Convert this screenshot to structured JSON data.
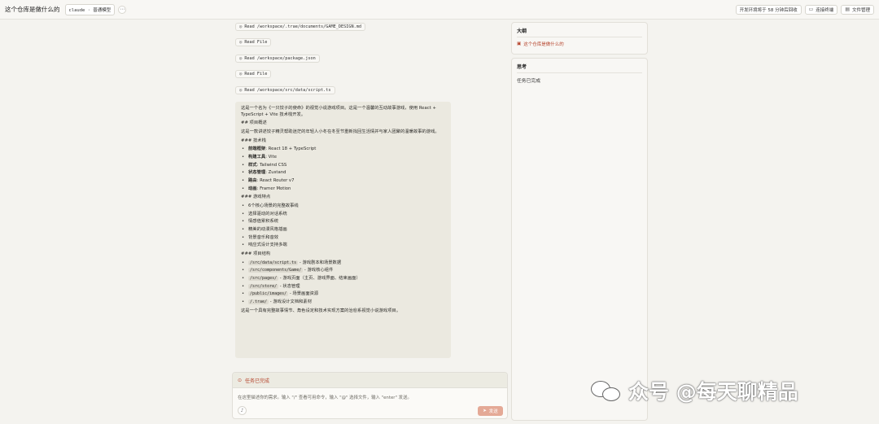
{
  "topbar": {
    "title": "这个仓库是做什么的",
    "model": "claude · 普通模型",
    "more": "⋯",
    "env_notice": "开发环境将于 58 分钟后回收",
    "connect_terminal": "连接终端",
    "file_manager": "文件管理"
  },
  "tool_calls": [
    {
      "label": "Read /workspace/.trae/documents/GAME_DESIGN.md"
    },
    {
      "label": "Read File"
    },
    {
      "label": "Read /workspace/package.json"
    },
    {
      "label": "Read File"
    },
    {
      "label": "Read /workspace/src/data/script.ts"
    }
  ],
  "answer": {
    "intro": "这是一个名为《一只饺子的使命》的视觉小说游戏项目。这是一个温馨的互动故事游戏，使用 React + TypeScript + Vite 技术栈开发。",
    "h_overview": "## 项目概述",
    "overview": "这是一款讲述饺子精灵帮助迷茫的年轻人小冬在冬至节重新找回生活情并与家人团聚的温暖故事的游戏。",
    "h_tech": "### 技术栈",
    "tech": [
      {
        "k": "前端框架",
        "v": ": React 18 + TypeScript"
      },
      {
        "k": "构建工具",
        "v": ": Vite"
      },
      {
        "k": "样式",
        "v": ": Tailwind CSS"
      },
      {
        "k": "状态管理",
        "v": ": Zustand"
      },
      {
        "k": "路由",
        "v": ": React Router v7"
      },
      {
        "k": "动画",
        "v": ": Framer Motion"
      }
    ],
    "h_features": "### 游戏特点",
    "features": [
      "6个核心场景的完整故事线",
      "选择驱动的对话系统",
      "情感值累积系统",
      "精美的动漫风格插画",
      "背景音乐和音效",
      "响应式设计支持多端"
    ],
    "h_structure": "### 项目结构",
    "structure": [
      {
        "path": "/src/data/script.ts",
        "desc": " - 游戏剧本和场景数据"
      },
      {
        "path": "/src/components/Game/",
        "desc": " - 游戏核心组件"
      },
      {
        "path": "/src/pages/",
        "desc": " - 游戏页面（主页、游戏界面、结束画面）"
      },
      {
        "path": "/src/store/",
        "desc": " - 状态管理"
      },
      {
        "path": "/public/images/",
        "desc": " - 场景画面资源"
      },
      {
        "path": "/.trae/",
        "desc": " - 游戏设计文档和素材"
      }
    ],
    "summary": "这是一个具有完整故事情节、角色设定和技术实现方案的治愈系视觉小说游戏项目。"
  },
  "composer": {
    "status": "任务已完成",
    "placeholder": "在这里描述你的需求。输入 \"/\" 查看可用命令，输入 \"@\" 选择文件，输入 \"enter\" 发送。",
    "send": "发送"
  },
  "outline": {
    "title": "大纲",
    "item": "这个仓库是做什么的"
  },
  "thinking": {
    "title": "思考",
    "text": "任务已完成"
  },
  "watermark": "众号 @每天聊精品",
  "colors": {
    "accent": "#b5442c",
    "send_bg": "#e4a996",
    "answer_bg": "#ebe9e0"
  }
}
